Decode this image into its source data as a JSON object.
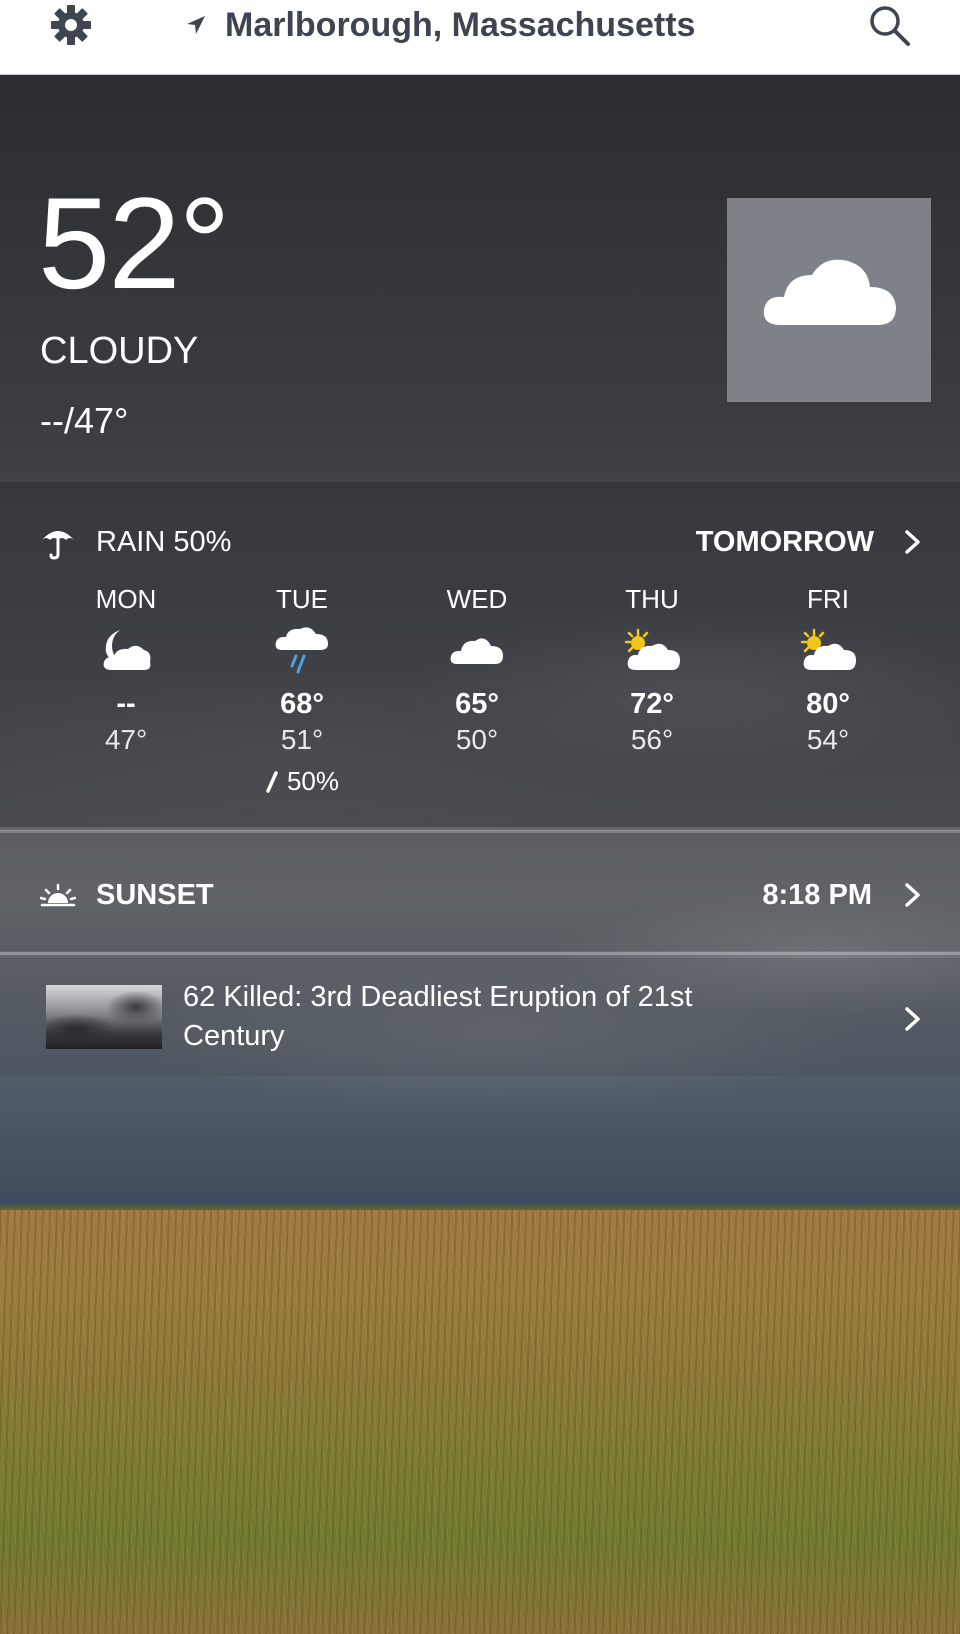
{
  "header": {
    "location": "Marlborough, Massachusetts",
    "settings_icon": "gear-icon",
    "search_icon": "search-icon",
    "location_icon": "location-arrow-icon"
  },
  "current": {
    "temperature": "52°",
    "condition": "CLOUDY",
    "hi_lo": "--/47°",
    "condition_icon": "cloud-icon"
  },
  "rain": {
    "label": "RAIN 50%",
    "icon": "umbrella-icon"
  },
  "tomorrow": {
    "label": "TOMORROW"
  },
  "forecast": [
    {
      "day": "MON",
      "icon": "moon-cloud-icon",
      "hi": "--",
      "lo": "47°",
      "precip": ""
    },
    {
      "day": "TUE",
      "icon": "rain-cloud-icon",
      "hi": "68°",
      "lo": "51°",
      "precip": "50%"
    },
    {
      "day": "WED",
      "icon": "cloud-icon",
      "hi": "65°",
      "lo": "50°",
      "precip": ""
    },
    {
      "day": "THU",
      "icon": "partly-sunny-icon",
      "hi": "72°",
      "lo": "56°",
      "precip": ""
    },
    {
      "day": "FRI",
      "icon": "partly-sunny-icon",
      "hi": "80°",
      "lo": "54°",
      "precip": ""
    }
  ],
  "sunset": {
    "label": "SUNSET",
    "time": "8:18 PM",
    "icon": "sunset-icon"
  },
  "news": {
    "headline": "62 Killed: 3rd Deadliest Eruption of 21st Century"
  },
  "colors": {
    "header_bg": "#ffffff",
    "header_text": "#3e4450",
    "sun_yellow": "#f5c518",
    "rain_blue": "#4aa3df"
  }
}
